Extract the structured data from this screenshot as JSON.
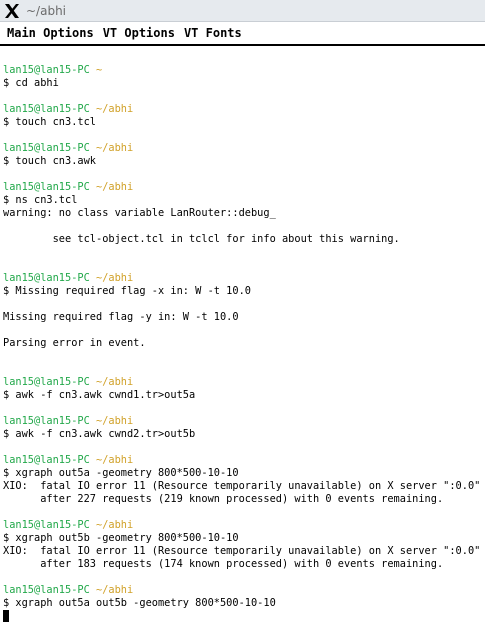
{
  "window": {
    "title": "~/abhi",
    "icon": "x-window-logo-icon"
  },
  "menu": [
    {
      "label": "Main Options"
    },
    {
      "label": "VT Options"
    },
    {
      "label": "VT Fonts"
    }
  ],
  "terminal": {
    "lines": [
      {
        "type": "prompt",
        "user": "lan15@lan15-PC",
        "path": "~"
      },
      {
        "type": "text",
        "text": "$ cd abhi"
      },
      {
        "type": "blank"
      },
      {
        "type": "prompt",
        "user": "lan15@lan15-PC",
        "path": "~/abhi"
      },
      {
        "type": "text",
        "text": "$ touch cn3.tcl"
      },
      {
        "type": "blank"
      },
      {
        "type": "prompt",
        "user": "lan15@lan15-PC",
        "path": "~/abhi"
      },
      {
        "type": "text",
        "text": "$ touch cn3.awk"
      },
      {
        "type": "blank"
      },
      {
        "type": "prompt",
        "user": "lan15@lan15-PC",
        "path": "~/abhi"
      },
      {
        "type": "text",
        "text": "$ ns cn3.tcl"
      },
      {
        "type": "text",
        "text": "warning: no class variable LanRouter::debug_"
      },
      {
        "type": "blank"
      },
      {
        "type": "text",
        "text": "        see tcl-object.tcl in tclcl for info about this warning."
      },
      {
        "type": "blank"
      },
      {
        "type": "blank"
      },
      {
        "type": "prompt",
        "user": "lan15@lan15-PC",
        "path": "~/abhi"
      },
      {
        "type": "text",
        "text": "$ Missing required flag -x in: W -t 10.0"
      },
      {
        "type": "blank"
      },
      {
        "type": "text",
        "text": "Missing required flag -y in: W -t 10.0"
      },
      {
        "type": "blank"
      },
      {
        "type": "text",
        "text": "Parsing error in event."
      },
      {
        "type": "blank"
      },
      {
        "type": "blank"
      },
      {
        "type": "prompt",
        "user": "lan15@lan15-PC",
        "path": "~/abhi"
      },
      {
        "type": "text",
        "text": "$ awk -f cn3.awk cwnd1.tr>out5a"
      },
      {
        "type": "blank"
      },
      {
        "type": "prompt",
        "user": "lan15@lan15-PC",
        "path": "~/abhi"
      },
      {
        "type": "text",
        "text": "$ awk -f cn3.awk cwnd2.tr>out5b"
      },
      {
        "type": "blank"
      },
      {
        "type": "prompt",
        "user": "lan15@lan15-PC",
        "path": "~/abhi"
      },
      {
        "type": "text",
        "text": "$ xgraph out5a -geometry 800*500-10-10"
      },
      {
        "type": "text",
        "text": "XIO:  fatal IO error 11 (Resource temporarily unavailable) on X server \":0.0\""
      },
      {
        "type": "text",
        "text": "      after 227 requests (219 known processed) with 0 events remaining."
      },
      {
        "type": "blank"
      },
      {
        "type": "prompt",
        "user": "lan15@lan15-PC",
        "path": "~/abhi"
      },
      {
        "type": "text",
        "text": "$ xgraph out5b -geometry 800*500-10-10"
      },
      {
        "type": "text",
        "text": "XIO:  fatal IO error 11 (Resource temporarily unavailable) on X server \":0.0\""
      },
      {
        "type": "text",
        "text": "      after 183 requests (174 known processed) with 0 events remaining."
      },
      {
        "type": "blank"
      },
      {
        "type": "prompt",
        "user": "lan15@lan15-PC",
        "path": "~/abhi"
      },
      {
        "type": "text",
        "text": "$ xgraph out5a out5b -geometry 800*500-10-10"
      },
      {
        "type": "cursor"
      }
    ]
  },
  "colors": {
    "prompt_user": "#22a84a",
    "prompt_path": "#d1a22a",
    "text": "#000000",
    "background": "#ffffff"
  }
}
